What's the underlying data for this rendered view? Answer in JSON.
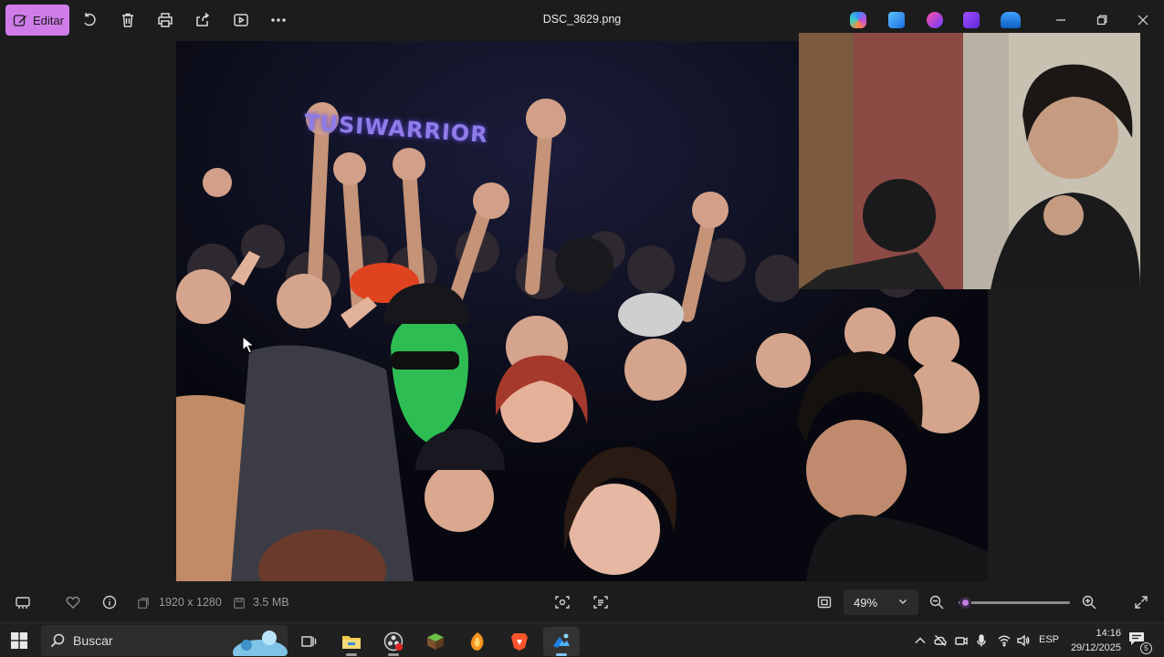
{
  "titlebar": {
    "edit_label": "Editar",
    "file_name": "DSC_3629.png",
    "tools": [
      "rotate-icon",
      "delete-icon",
      "print-icon",
      "share-icon",
      "slideshow-icon",
      "more-icon"
    ],
    "app_icons": [
      "copilot-icon",
      "photos-app-icon",
      "clipchamp-icon",
      "video-editor-icon",
      "onedrive-icon"
    ]
  },
  "photo": {
    "sign_text": "TUSIWARRIOR"
  },
  "bottombar": {
    "resolution": "1920 x 1280",
    "file_size": "3.5 MB",
    "zoom_value": "49%",
    "zoom_level_percent": 49
  },
  "taskbar": {
    "search_placeholder": "Buscar",
    "language": "ESP",
    "time": "14:16",
    "date": "29/12/2025",
    "notifications": "5"
  },
  "colors": {
    "accent": "#cf7ce8",
    "slider_accent": "#c27be0",
    "background": "#1c1c1c",
    "taskbar": "#202020"
  }
}
